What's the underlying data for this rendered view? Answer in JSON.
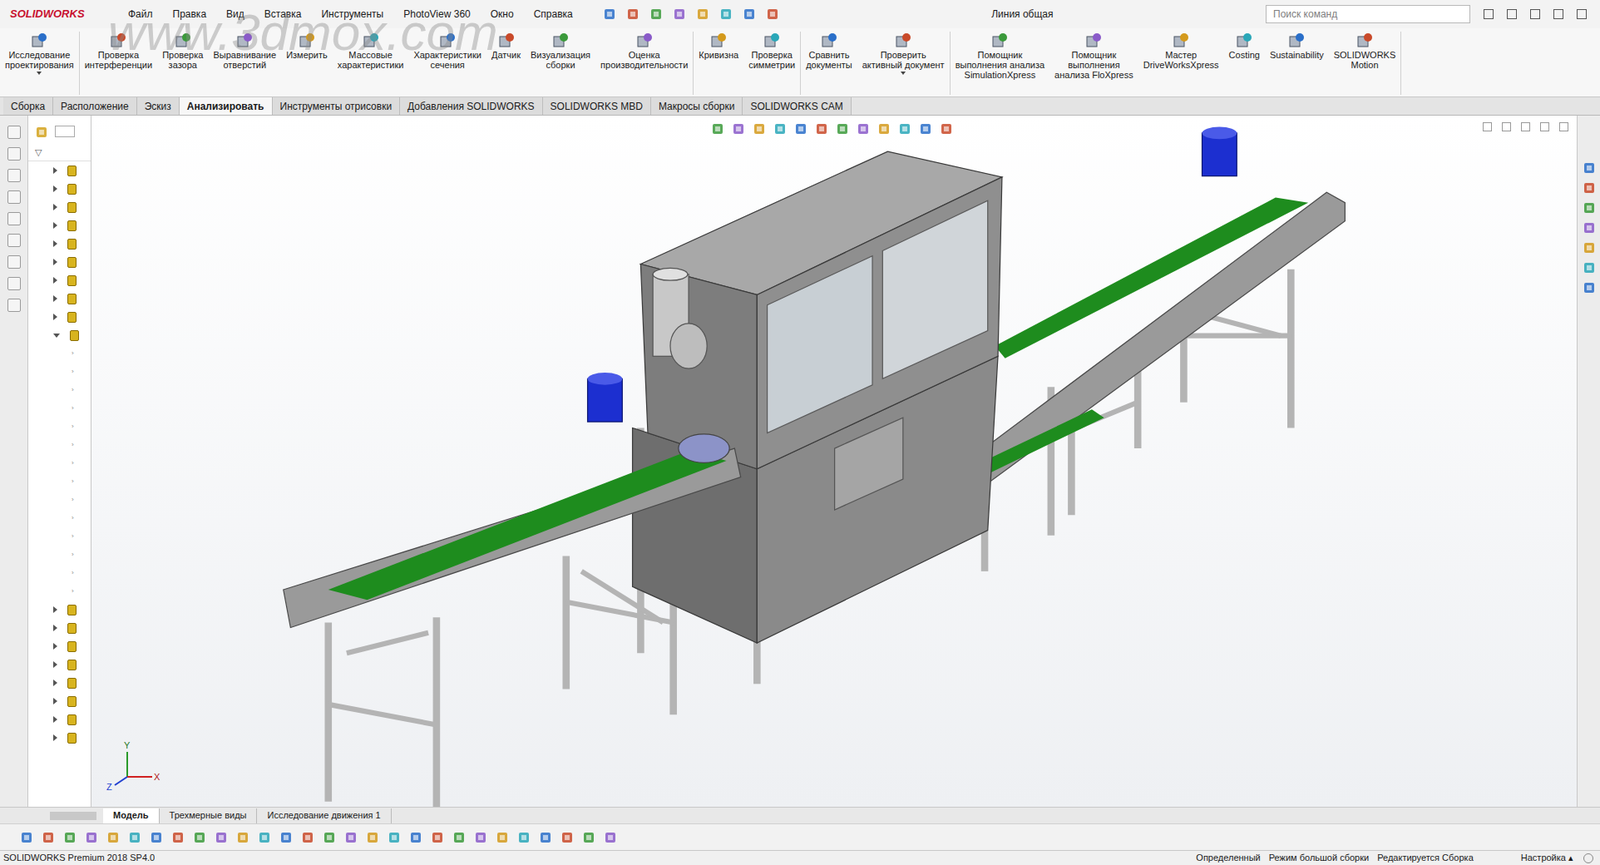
{
  "app": {
    "logo": "SOLIDWORKS",
    "watermark": "www.3dmox.com",
    "title": "Линия общая"
  },
  "menu": [
    "Файл",
    "Правка",
    "Вид",
    "Вставка",
    "Инструменты",
    "PhotoView 360",
    "Окно",
    "Справка"
  ],
  "search": {
    "placeholder": "Поиск команд"
  },
  "ribbon": {
    "groups": [
      [
        {
          "lines": [
            "Исследование",
            "проектирования"
          ],
          "dropdown": true
        }
      ],
      [
        {
          "lines": [
            "Проверка",
            "интерференции"
          ],
          "dropdown": false
        },
        {
          "lines": [
            "Проверка",
            "зазора"
          ],
          "dropdown": false
        },
        {
          "lines": [
            "Выравнивание",
            "отверстий"
          ],
          "dropdown": false
        },
        {
          "lines": [
            "Измерить"
          ],
          "dropdown": false
        },
        {
          "lines": [
            "Массовые",
            "характеристики"
          ],
          "dropdown": false
        },
        {
          "lines": [
            "Характеристики",
            "сечения"
          ],
          "dropdown": false
        },
        {
          "lines": [
            "Датчик"
          ],
          "dropdown": false
        },
        {
          "lines": [
            "Визуализация",
            "сборки"
          ],
          "dropdown": false
        },
        {
          "lines": [
            "Оценка",
            "производительности"
          ],
          "dropdown": false
        }
      ],
      [
        {
          "lines": [
            "Кривизна"
          ],
          "dropdown": false
        },
        {
          "lines": [
            "Проверка",
            "симметрии"
          ],
          "dropdown": false
        }
      ],
      [
        {
          "lines": [
            "Сравнить",
            "документы"
          ],
          "dropdown": false
        },
        {
          "lines": [
            "Проверить",
            "активный документ"
          ],
          "dropdown": true
        }
      ],
      [
        {
          "lines": [
            "Помощник",
            "выполнения анализа",
            "SimulationXpress"
          ],
          "dropdown": false
        },
        {
          "lines": [
            "Помощник",
            "выполнения",
            "анализа FloXpress"
          ],
          "dropdown": false
        },
        {
          "lines": [
            "Мастер",
            "DriveWorksXpress"
          ],
          "dropdown": false
        },
        {
          "lines": [
            "Costing"
          ],
          "dropdown": false
        },
        {
          "lines": [
            "Sustainability"
          ],
          "dropdown": false
        },
        {
          "lines": [
            "SOLIDWORKS",
            "Motion"
          ],
          "dropdown": false
        }
      ]
    ]
  },
  "tabs": [
    {
      "label": "Сборка",
      "selected": false
    },
    {
      "label": "Расположение",
      "selected": false
    },
    {
      "label": "Эскиз",
      "selected": false
    },
    {
      "label": "Анализировать",
      "selected": true
    },
    {
      "label": "Инструменты отрисовки",
      "selected": false
    },
    {
      "label": "Добавления SOLIDWORKS",
      "selected": false
    },
    {
      "label": "SOLIDWORKS MBD",
      "selected": false
    },
    {
      "label": "Макросы сборки",
      "selected": false
    },
    {
      "label": "SOLIDWORKS CAM",
      "selected": false
    }
  ],
  "tree": {
    "items": [
      {
        "child": false,
        "expanded": false
      },
      {
        "child": false,
        "expanded": false
      },
      {
        "child": false,
        "expanded": false
      },
      {
        "child": false,
        "expanded": false
      },
      {
        "child": false,
        "expanded": false
      },
      {
        "child": false,
        "expanded": false
      },
      {
        "child": false,
        "expanded": false
      },
      {
        "child": false,
        "expanded": false
      },
      {
        "child": false,
        "expanded": false
      },
      {
        "child": false,
        "expanded": true
      },
      {
        "child": true,
        "expanded": false
      },
      {
        "child": true,
        "expanded": false
      },
      {
        "child": true,
        "expanded": false
      },
      {
        "child": true,
        "expanded": false
      },
      {
        "child": true,
        "expanded": false
      },
      {
        "child": true,
        "expanded": false
      },
      {
        "child": true,
        "expanded": false
      },
      {
        "child": true,
        "expanded": false
      },
      {
        "child": true,
        "expanded": false
      },
      {
        "child": true,
        "expanded": false
      },
      {
        "child": true,
        "expanded": false
      },
      {
        "child": true,
        "expanded": false
      },
      {
        "child": true,
        "expanded": false
      },
      {
        "child": true,
        "expanded": false
      },
      {
        "child": false,
        "expanded": false
      },
      {
        "child": false,
        "expanded": false
      },
      {
        "child": false,
        "expanded": false
      },
      {
        "child": false,
        "expanded": false
      },
      {
        "child": false,
        "expanded": false
      },
      {
        "child": false,
        "expanded": false
      },
      {
        "child": false,
        "expanded": false
      },
      {
        "child": false,
        "expanded": false
      }
    ]
  },
  "axes": {
    "x": "X",
    "y": "Y",
    "z": "Z"
  },
  "bottom_tabs": [
    {
      "label": "Модель",
      "selected": true
    },
    {
      "label": "Трехмерные виды",
      "selected": false
    },
    {
      "label": "Исследование движения 1",
      "selected": false
    }
  ],
  "status_bar": {
    "product": "SOLIDWORKS Premium 2018 SP4.0",
    "items": [
      "Определенный",
      "Режим большой сборки",
      "Редактируется Сборка"
    ],
    "config": "Настройка"
  }
}
